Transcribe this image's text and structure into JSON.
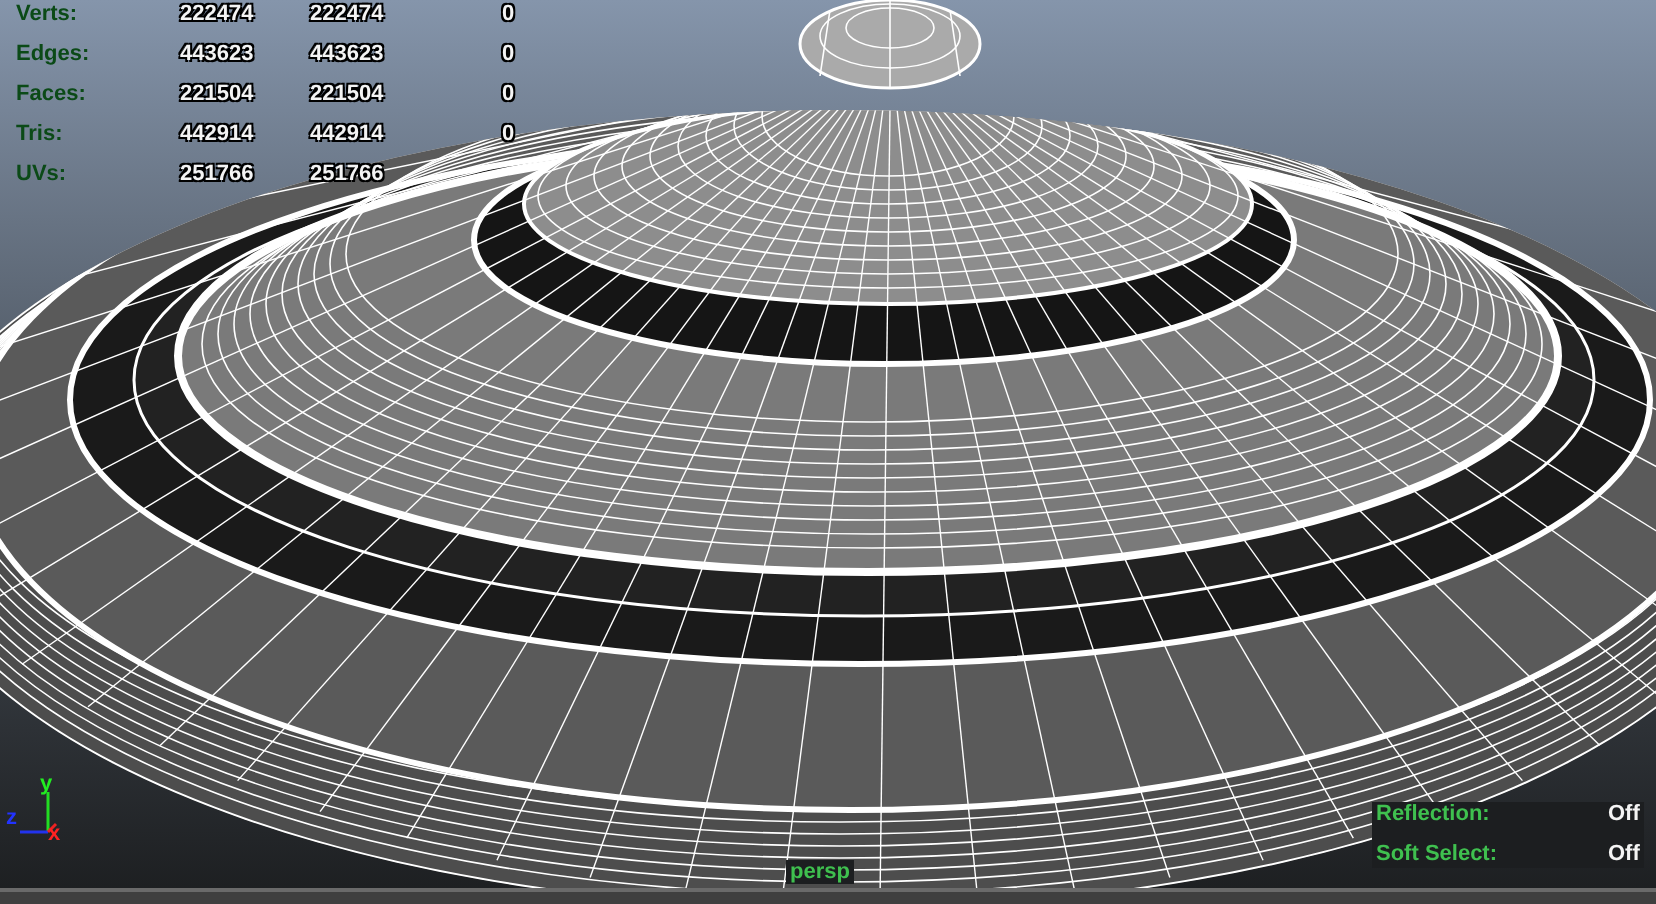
{
  "stats": [
    {
      "label": "Verts:",
      "values": [
        "222474",
        "222474",
        "0"
      ]
    },
    {
      "label": "Edges:",
      "values": [
        "443623",
        "443623",
        "0"
      ]
    },
    {
      "label": "Faces:",
      "values": [
        "221504",
        "221504",
        "0"
      ]
    },
    {
      "label": "Tris:",
      "values": [
        "442914",
        "442914",
        "0"
      ]
    },
    {
      "label": "UVs:",
      "values": [
        "251766",
        "251766"
      ]
    }
  ],
  "axis": {
    "y": "y",
    "z": "z",
    "x": "x"
  },
  "camera": "persp",
  "settings": [
    {
      "label": "Reflection:",
      "value": "Off"
    },
    {
      "label": "Soft Select:",
      "value": "Off"
    }
  ]
}
